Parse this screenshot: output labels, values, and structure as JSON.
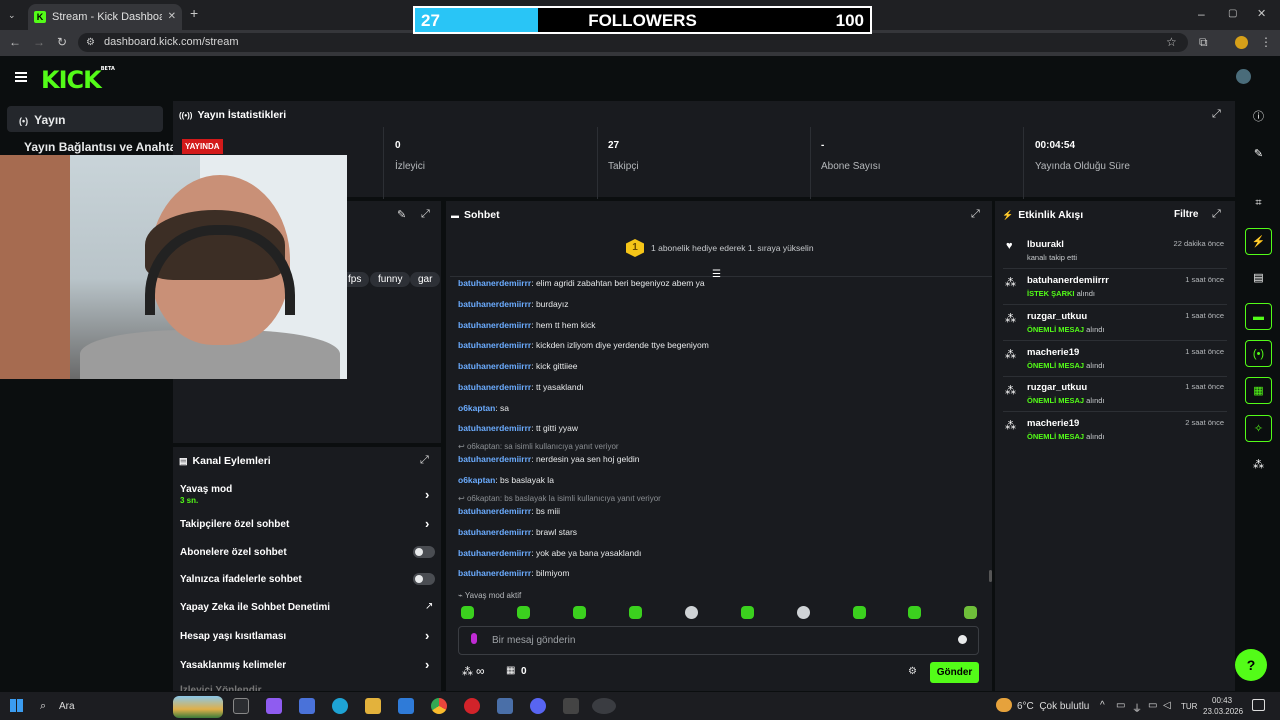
{
  "browser": {
    "tab_title": "Stream - Kick Dashboard",
    "tab_favicon": "K",
    "url": "dashboard.kick.com/stream",
    "close_tab": "✕",
    "new_tab": "+"
  },
  "followers_goal": {
    "current": "27",
    "label": "FOLLOWERS",
    "goal": "100",
    "progress": 0.27
  },
  "header": {
    "logo": "KICK",
    "logo_badge": "BETA"
  },
  "sidebar": {
    "items": [
      {
        "label": "Yayın",
        "icon": "broadcast-icon"
      },
      {
        "label": "Yayın Bağlantısı ve Anahtarı"
      }
    ]
  },
  "stats": {
    "title": "Yayın İstatistikleri",
    "live_badge": "YAYINDA",
    "items": [
      {
        "value": "0",
        "label": "İzleyici"
      },
      {
        "value": "27",
        "label": "Takipçi"
      },
      {
        "value": "-",
        "label": "Abone Sayısı"
      },
      {
        "value": "00:04:54",
        "label": "Yayında Olduğu Süre"
      }
    ]
  },
  "stream_info": {
    "tags": [
      "fps",
      "funny",
      "gar"
    ]
  },
  "chat": {
    "title": "Sohbet",
    "pinned_rank": "1",
    "pinned_text": "1 abonelik hediye ederek 1. sıraya yükselin",
    "messages": [
      {
        "user": "batuhanerdemiirrr",
        "text": ": elim agridi zabahtan beri begeniyoz abem ya"
      },
      {
        "user": "batuhanerdemiirrr",
        "text": ": burdayız"
      },
      {
        "user": "batuhanerdemiirrr",
        "text": ": hem tt hem kick"
      },
      {
        "user": "batuhanerdemiirrr",
        "text": ": kickden izliyom diye yerdende ttye begeniyom"
      },
      {
        "user": "batuhanerdemiirrr",
        "text": ": kick gittiiee"
      },
      {
        "user": "batuhanerdemiirrr",
        "text": ": tt yasaklandı"
      },
      {
        "user": "o6kaptan",
        "text": ": sa"
      },
      {
        "user": "batuhanerdemiirrr",
        "text": ": tt gitti yyaw"
      },
      {
        "reply": "o6kaptan: sa isimli kullanıcıya yanıt veriyor",
        "user": "batuhanerdemiirrr",
        "text": ": nerdesin yaa sen hoj geldin"
      },
      {
        "user": "o6kaptan",
        "text": ": bs baslayak la"
      },
      {
        "reply": "o6kaptan: bs baslayak la isimli kullanıcıya yanıt veriyor",
        "user": "batuhanerdemiirrr",
        "text": ": bs miii"
      },
      {
        "user": "batuhanerdemiirrr",
        "text": ": brawl stars"
      },
      {
        "user": "batuhanerdemiirrr",
        "text": ": yok abe ya bana yasaklandı"
      },
      {
        "user": "batuhanerdemiirrr",
        "text": ": bilmiyom"
      }
    ],
    "slow_mode_notice": "Yavaş mod aktif",
    "input_placeholder": "Bir mesaj gönderin",
    "points": "∞",
    "count": "0",
    "send_label": "Gönder"
  },
  "channel_actions": {
    "title": "Kanal Eylemleri",
    "items": [
      {
        "label": "Yavaş mod",
        "sub": "3 sn.",
        "control": "chevron"
      },
      {
        "label": "Takipçilere özel sohbet",
        "control": "chevron"
      },
      {
        "label": "Abonelere özel sohbet",
        "control": "toggle"
      },
      {
        "label": "Yalnızca ifadelerle sohbet",
        "control": "toggle"
      },
      {
        "label": "Yapay Zeka ile Sohbet Denetimi",
        "control": "external"
      },
      {
        "label": "Hesap yaşı kısıtlaması",
        "control": "chevron"
      },
      {
        "label": "Yasaklanmış kelimeler",
        "control": "chevron"
      },
      {
        "label": "İzleyici Yönlendir"
      }
    ]
  },
  "activity": {
    "title": "Etkinlik Akışı",
    "filter_label": "Filtre",
    "events": [
      {
        "name": "lbuurakl",
        "sub": "kanalı takip etti",
        "highlight": "",
        "time": "22 dakika önce",
        "icon": "heart-icon"
      },
      {
        "name": "batuhanerdemiirrr",
        "highlight": "İSTEK ŞARKI",
        "sub": " alındı",
        "time": "1 saat önce",
        "icon": "points-icon"
      },
      {
        "name": "ruzgar_utkuu",
        "highlight": "ÖNEMLİ MESAJ",
        "sub": " alındı",
        "time": "1 saat önce",
        "icon": "points-icon"
      },
      {
        "name": "macherie19",
        "highlight": "ÖNEMLİ MESAJ",
        "sub": " alındı",
        "time": "1 saat önce",
        "icon": "points-icon"
      },
      {
        "name": "ruzgar_utkuu",
        "highlight": "ÖNEMLİ MESAJ",
        "sub": " alındı",
        "time": "1 saat önce",
        "icon": "points-icon"
      },
      {
        "name": "macherie19",
        "highlight": "ÖNEMLİ MESAJ",
        "sub": " alındı",
        "time": "2 saat önce",
        "icon": "points-icon"
      }
    ]
  },
  "taskbar": {
    "search": "Ara",
    "weather": "6°C  Çok bulutlu",
    "lang": "TUR",
    "time": "00:43",
    "date": "23.03.2026"
  },
  "colors": {
    "accent": "#53fc18",
    "username": "#6bacff",
    "live": "#d31a1a",
    "panel": "#191b1f"
  }
}
